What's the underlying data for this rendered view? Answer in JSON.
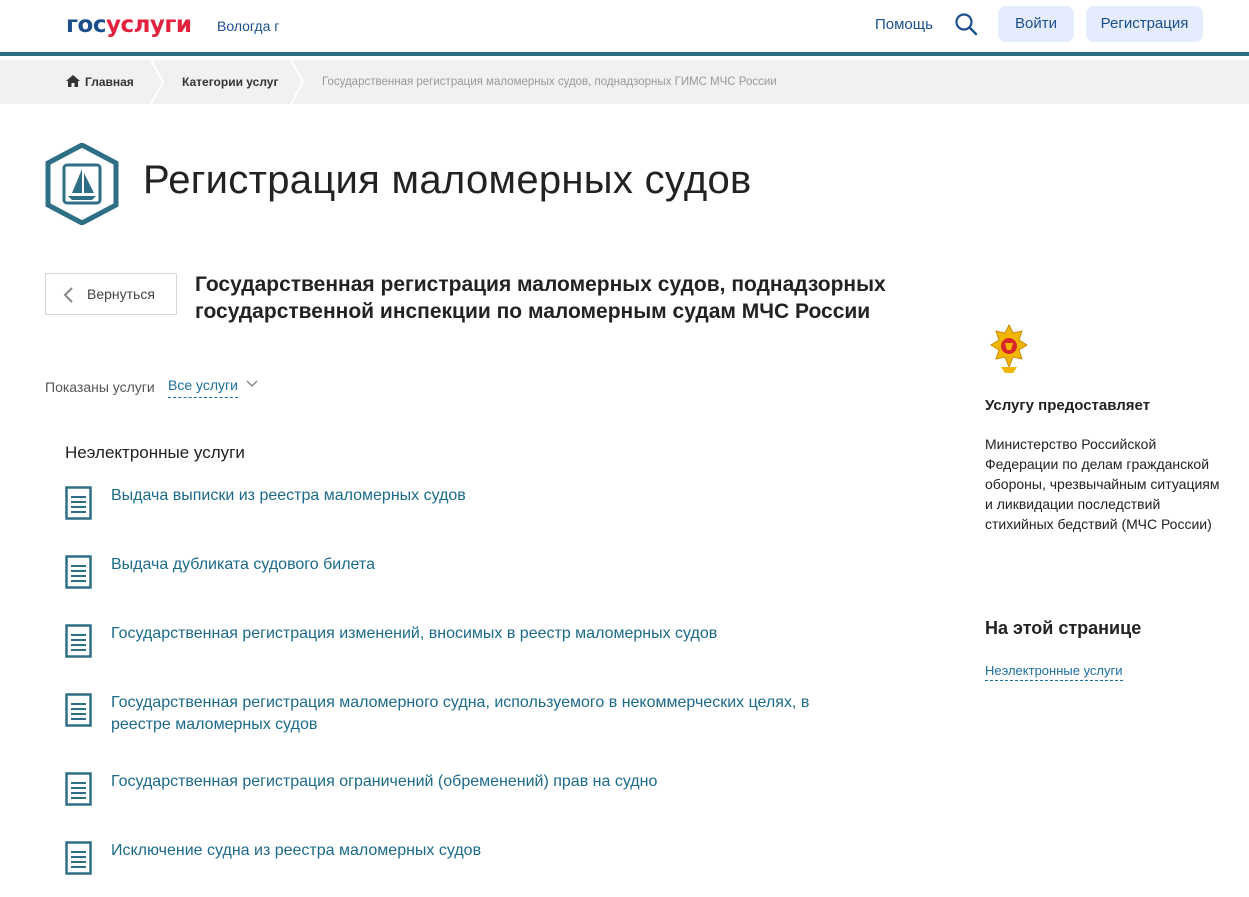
{
  "header": {
    "logo_part1": "гос",
    "logo_part2": "услуги",
    "city": "Вологда г",
    "help": "Помощь",
    "login": "Войти",
    "register": "Регистрация"
  },
  "breadcrumbs": {
    "home": "Главная",
    "categories": "Категории услуг",
    "current": "Государственная регистрация маломерных судов, поднадзорных ГИМС МЧС России"
  },
  "page": {
    "title": "Регистрация маломерных судов",
    "back": "Вернуться",
    "service_title": "Государственная регистрация маломерных судов, поднадзорных государственной инспекции по маломерным судам МЧС России",
    "shown_label": "Показаны услуги",
    "filter_value": "Все услуги",
    "section_title": "Неэлектронные услуги",
    "services": [
      "Выдача выписки из реестра маломерных судов",
      "Выдача дубликата судового билета",
      "Государственная регистрация изменений, вносимых в реестр маломерных судов",
      "Государственная регистрация маломерного судна, используемого в некоммерческих целях, в реестре маломерных судов",
      "Государственная регистрация ограничений (обременений) прав на судно",
      "Исключение судна из реестра маломерных судов"
    ]
  },
  "sidebar": {
    "provider_title": "Услугу предоставляет",
    "provider_text": "Министерство Российской Федерации по делам гражданской обороны, чрезвычайным ситуациям и ликвидации последствий стихийных бедствий (МЧС России)",
    "onpage_title": "На этой странице",
    "onpage_link": "Неэлектронные услуги"
  },
  "icons": {
    "search": "search-icon",
    "home": "home-icon",
    "back": "chevron-left-icon",
    "dropdown": "chevron-down-icon",
    "document": "document-icon",
    "emblem": "boat-emblem-icon",
    "mchs": "mchs-emblem-icon"
  },
  "colors": {
    "accent": "#1b4f8c",
    "link": "#1b6a8a",
    "logo_red": "#e3223d",
    "header_bar": "#2f6f86",
    "button_bg": "#e4ecfd"
  }
}
